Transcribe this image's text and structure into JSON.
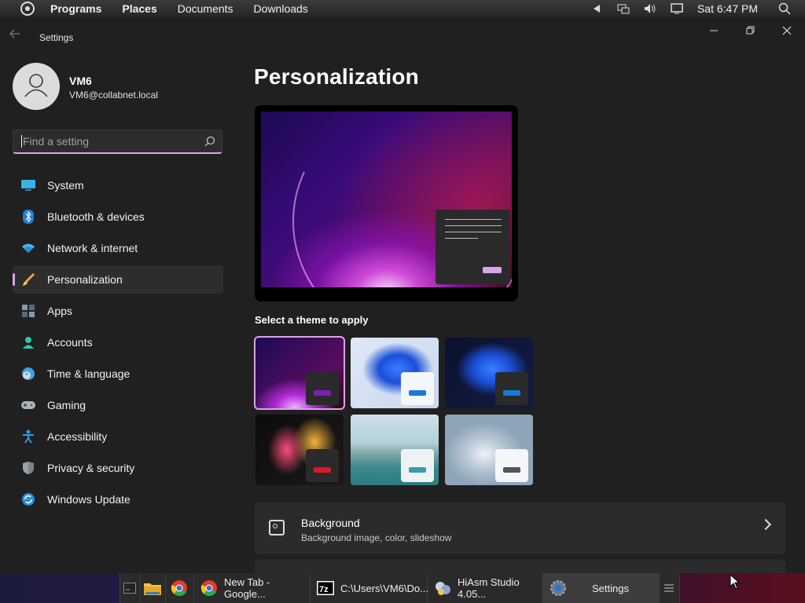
{
  "top_panel": {
    "menus": [
      "Programs",
      "Places",
      "Documents",
      "Downloads"
    ],
    "clock": "Sat 6:47 PM",
    "icons": [
      "menu-logo-icon",
      "arrow-left-icon",
      "network-icon",
      "volume-icon",
      "display-icon",
      "search-icon"
    ]
  },
  "window": {
    "title": "Settings",
    "profile": {
      "name": "VM6",
      "email": "VM6@collabnet.local"
    },
    "search": {
      "placeholder": "Find a setting",
      "value": ""
    },
    "nav": [
      {
        "label": "System",
        "icon": "system-icon"
      },
      {
        "label": "Bluetooth & devices",
        "icon": "bluetooth-icon"
      },
      {
        "label": "Network & internet",
        "icon": "wifi-icon"
      },
      {
        "label": "Personalization",
        "icon": "brush-icon",
        "active": true
      },
      {
        "label": "Apps",
        "icon": "apps-icon"
      },
      {
        "label": "Accounts",
        "icon": "accounts-icon"
      },
      {
        "label": "Time & language",
        "icon": "time-language-icon"
      },
      {
        "label": "Gaming",
        "icon": "gaming-icon"
      },
      {
        "label": "Accessibility",
        "icon": "accessibility-icon"
      },
      {
        "label": "Privacy & security",
        "icon": "shield-icon"
      },
      {
        "label": "Windows Update",
        "icon": "update-icon"
      }
    ],
    "page_title": "Personalization",
    "select_theme_label": "Select a theme to apply",
    "background_row": {
      "title": "Background",
      "subtitle": "Background image, color, slideshow"
    }
  },
  "taskbar": {
    "items": [
      {
        "label": "",
        "icon": "terminal-icon"
      },
      {
        "label": "",
        "icon": "folder-icon"
      },
      {
        "label": "",
        "icon": "chrome-icon"
      },
      {
        "label": "New Tab - Google...",
        "icon": "chrome-icon"
      },
      {
        "label": "C:\\Users\\VM6\\Do...",
        "icon": "7zip-icon"
      },
      {
        "label": "HiAsm Studio 4.05...",
        "icon": "hiasm-icon"
      },
      {
        "label": "Settings",
        "icon": "settings-gear-icon",
        "active": true
      },
      {
        "label": "",
        "icon": "hamburger-menu-icon"
      }
    ]
  },
  "colors": {
    "accent": "#d9a5e6",
    "background": "#202020",
    "card": "#2b2b2b"
  }
}
